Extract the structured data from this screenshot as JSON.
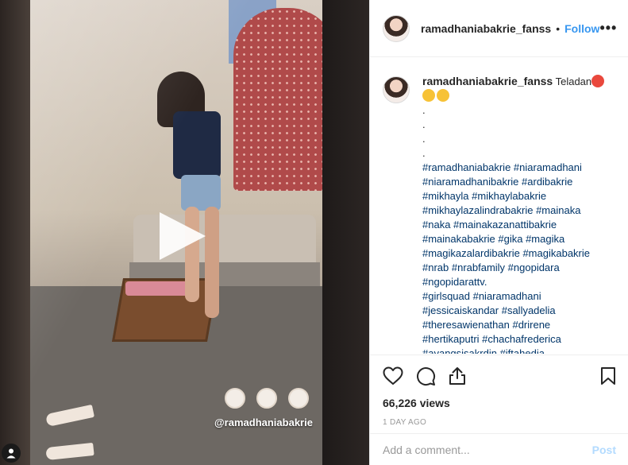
{
  "post": {
    "username": "ramadhaniabakrie_fanss",
    "separator": "•",
    "follow_label": "Follow",
    "more_label": "•••"
  },
  "media": {
    "mention": "@ramadhaniabakrie",
    "play_icon": "play-icon",
    "user_icon": "user-icon"
  },
  "caption": {
    "username": "ramadhaniabakrie_fanss",
    "text": "Teladan",
    "dots": [
      ".",
      ".",
      ".",
      "."
    ],
    "hashtag_lines": [
      "#ramadhaniabakrie #niaramadhani",
      "#niaramadhanibakrie #ardibakrie",
      "#mikhayla #mikhaylabakrie",
      "#mikhaylazalindrabakrie #mainaka",
      "#naka #mainakazanattibakrie",
      "#mainakabakrie #gika #magika",
      "#magikazalardibakrie #magikabakrie",
      "#nrab #nrabfamily #ngopidara",
      "#ngopidarattv.",
      "#girlsquad #niaramadhani",
      "#jessicaiskandar #sallyadelia",
      "#theresawienathan #drirene",
      "#hertikaputri #chachafrederica",
      "#ayangsisakrdin #iftahedia"
    ]
  },
  "stats": {
    "views": "66,226 views",
    "time": "1 DAY AGO"
  },
  "comment": {
    "placeholder": "Add a comment...",
    "post_label": "Post"
  },
  "colors": {
    "link": "#3897f0",
    "hashtag": "#003569",
    "post_disabled": "#b3dbff"
  }
}
